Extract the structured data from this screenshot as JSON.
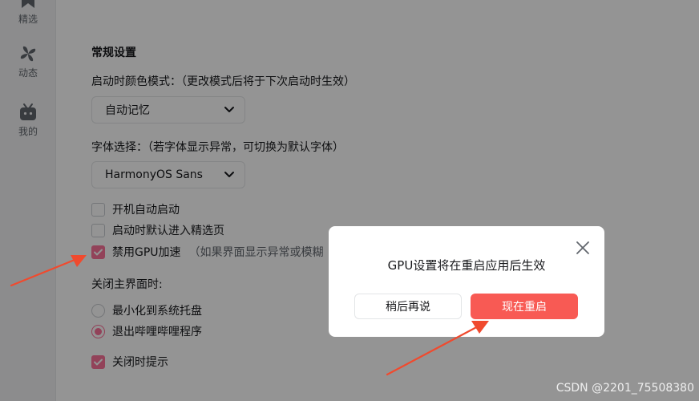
{
  "sidebar": {
    "items": [
      {
        "label": "精选",
        "icon": "bookmark-icon"
      },
      {
        "label": "动态",
        "icon": "pinwheel-icon"
      },
      {
        "label": "我的",
        "icon": "tv-icon"
      }
    ]
  },
  "settings": {
    "general_title": "常规设置",
    "color_mode": {
      "label": "启动时颜色模式：（更改模式后将于下次启动时生效）",
      "selected": "自动记忆"
    },
    "font": {
      "label": "字体选择：（若字体显示异常，可切换为默认字体）",
      "selected": "HarmonyOS Sans"
    },
    "checkboxes": [
      {
        "label": "开机自动启动",
        "checked": false
      },
      {
        "label": "启动时默认进入精选页",
        "checked": false
      },
      {
        "label": "禁用GPU加速",
        "checked": true,
        "hint": "（如果界面显示异常或模糊"
      }
    ],
    "close_behavior": {
      "label": "关闭主界面时:",
      "options": [
        {
          "label": "最小化到系统托盘",
          "checked": false
        },
        {
          "label": "退出哔哩哔哩程序",
          "checked": true
        }
      ]
    },
    "close_prompt": {
      "label": "关闭时提示",
      "checked": true
    }
  },
  "dialog": {
    "message": "GPU设置将在重启应用后生效",
    "later_label": "稍后再说",
    "restart_label": "现在重启"
  },
  "watermark": "CSDN @2201_75508380",
  "colors": {
    "accent": "#fb7299",
    "restart_button": "#f85a54",
    "annotation_arrow": "#f04a2e"
  }
}
